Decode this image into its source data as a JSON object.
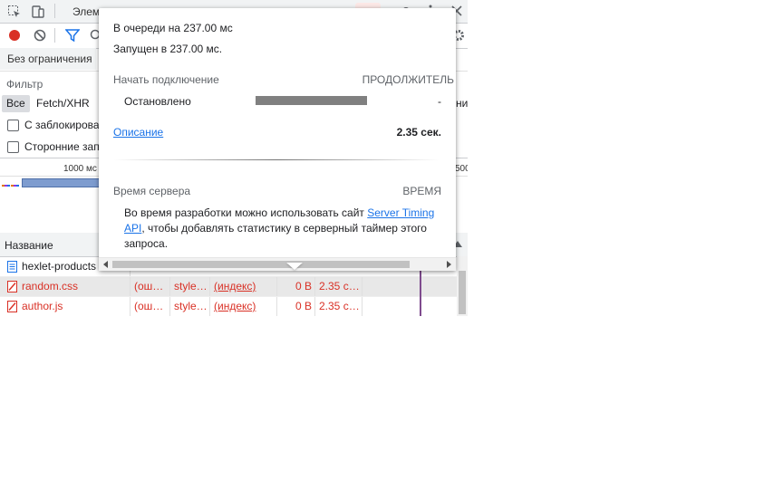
{
  "devtools": {
    "tabs": {
      "elements_partial": "Элем"
    },
    "toolbar": {
      "throttle_label": "Без ограничения"
    },
    "filter": {
      "placeholder": "Фильтр"
    },
    "types": {
      "all": "Все",
      "fetch_xhr": "Fetch/XHR",
      "partial_right": "ни"
    },
    "checks": {
      "blocked": "С заблокирова",
      "third_party": "Сторонние зап"
    },
    "overview": {
      "tick_left": "1000 мс",
      "tick_right": "500"
    },
    "table": {
      "name_header": "Название",
      "rows": [
        {
          "name": "hexlet-products",
          "status": "",
          "type": "",
          "initiator": "",
          "size": "",
          "time": "",
          "error": false
        },
        {
          "name": "random.css",
          "status": "(ош…",
          "type": "style…",
          "initiator": "(индекс)",
          "size": "0 B",
          "time": "2.35 с…",
          "error": true
        },
        {
          "name": "author.js",
          "status": "(ош…",
          "type": "style…",
          "initiator": "(индекс)",
          "size": "0 B",
          "time": "2.35 с…",
          "error": true
        }
      ]
    }
  },
  "popover": {
    "queued_text": "В очереди на 237.00 мс",
    "started_text": "Запущен в 237.00 мс.",
    "connection_start": "Начать подключение",
    "duration_header": "ПРОДОЛЖИТЕЛЬ",
    "stalled_label": "Остановлено",
    "stalled_value": "-",
    "explanation_link": "Описание",
    "total_time": "2.35 сек.",
    "server_timing": "Время сервера",
    "time_header": "ВРЕМЯ",
    "server_text_before": "Во время разработки можно использовать сайт ",
    "server_link": "Server Timing API",
    "server_text_after": ", чтобы добавлять статистику в серверный таймер этого запроса."
  },
  "colors": {
    "record_red": "#d93025",
    "filter_blue": "#1a73e8",
    "error_red": "#d93025",
    "stalled_bar": "#808080"
  }
}
